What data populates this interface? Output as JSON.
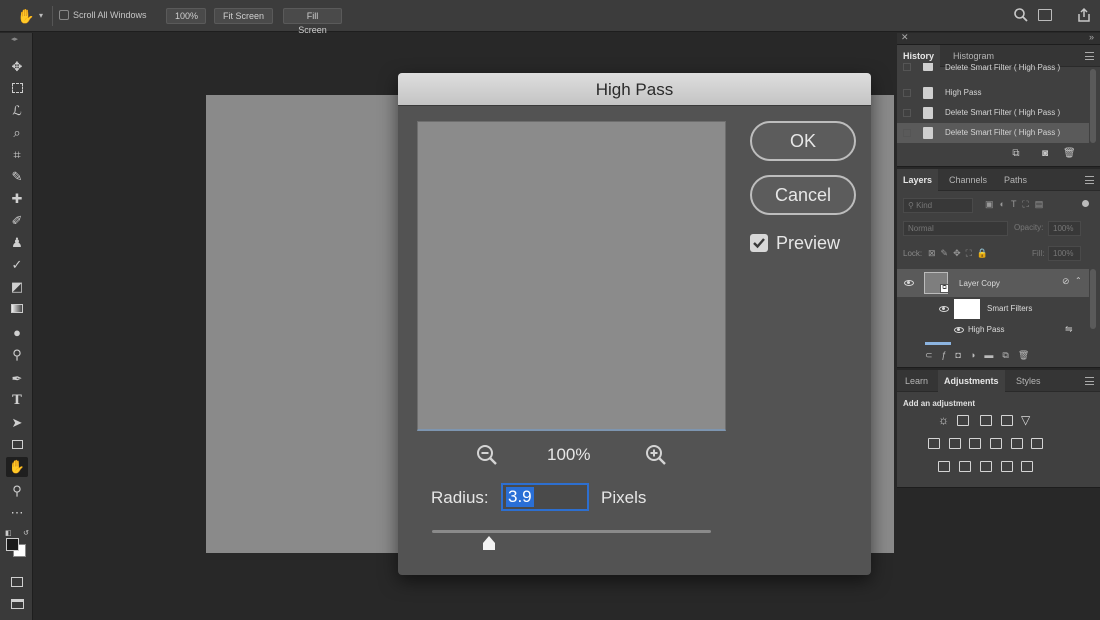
{
  "options_bar": {
    "scroll_all_windows_label": "Scroll All Windows",
    "zoom_button": "100%",
    "fit_screen_button": "Fit Screen",
    "fill_screen_button": "Fill Screen"
  },
  "tools": [
    "move-icon",
    "marquee-icon",
    "lasso-icon",
    "quick-select-icon",
    "crop-icon",
    "eyedropper-icon",
    "healing-icon",
    "brush-icon",
    "stamp-icon",
    "history-brush-icon",
    "eraser-icon",
    "gradient-icon",
    "blur-icon",
    "dodge-icon",
    "pen-icon",
    "type-icon",
    "path-select-icon",
    "rectangle-icon",
    "hand-icon",
    "zoom-icon",
    "more-icon"
  ],
  "dialog": {
    "title": "High Pass",
    "ok_label": "OK",
    "cancel_label": "Cancel",
    "preview_label": "Preview",
    "preview_checked": true,
    "zoom_level": "100%",
    "radius_label": "Radius:",
    "radius_value": "3.9",
    "pixels_label": "Pixels",
    "slider_fraction": 0.2
  },
  "history": {
    "tabs": [
      "History",
      "Histogram"
    ],
    "active_tab": "History",
    "items": [
      "Delete Smart Filter ( High Pass )",
      "High Pass",
      "Delete Smart Filter ( High Pass )",
      "Delete Smart Filter ( High Pass )"
    ],
    "selected_index": 3
  },
  "layers": {
    "tabs": [
      "Layers",
      "Channels",
      "Paths"
    ],
    "active_tab": "Layers",
    "kind_placeholder": "Kind",
    "blend_mode": "Normal",
    "opacity_label": "Opacity:",
    "opacity_value": "100%",
    "lock_label": "Lock:",
    "fill_label": "Fill:",
    "fill_value": "100%",
    "layer_name": "Layer Copy",
    "smart_filters_label": "Smart Filters",
    "filter_name": "High Pass"
  },
  "adjustments": {
    "tabs": [
      "Learn",
      "Adjustments",
      "Styles"
    ],
    "active_tab": "Adjustments",
    "title": "Add an adjustment"
  },
  "colors": {
    "accent_blue": "#2a6fd6",
    "app_bg": "#282828",
    "dialog_bg": "#535353"
  }
}
